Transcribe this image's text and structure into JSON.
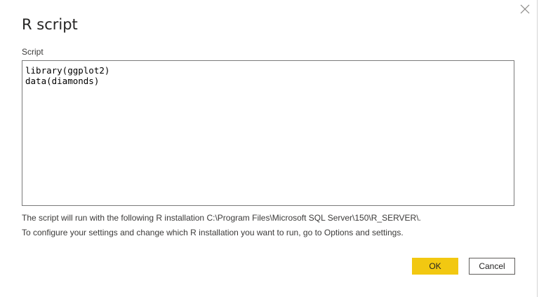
{
  "dialog": {
    "title": "R script",
    "close_icon": "close-icon"
  },
  "script_field": {
    "label": "Script",
    "value": "library(ggplot2)\ndata(diamonds)"
  },
  "info": {
    "line1": "The script will run with the following R installation C:\\Program Files\\Microsoft SQL Server\\150\\R_SERVER\\.",
    "line2": "To configure your settings and change which R installation you want to run, go to Options and settings."
  },
  "buttons": {
    "ok_label": "OK",
    "cancel_label": "Cancel"
  },
  "colors": {
    "accent": "#f2c811",
    "text": "#252423",
    "border": "#7a7a7a"
  }
}
